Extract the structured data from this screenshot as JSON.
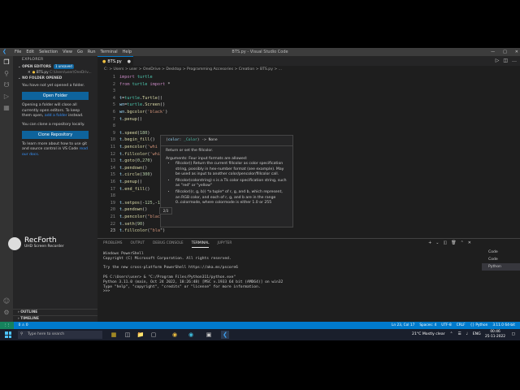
{
  "titlebar": {
    "menu": [
      "File",
      "Edit",
      "Selection",
      "View",
      "Go",
      "Run",
      "Terminal",
      "Help"
    ],
    "window_title": "BTS.py - Visual Studio Code"
  },
  "explorer": {
    "header": "EXPLORER",
    "open_editors_label": "OPEN EDITORS",
    "unsaved_badge": "1 unsaved",
    "open_file_name": "BTS.py",
    "open_file_path": "C:\\Users\\user\\OneDriv...",
    "no_folder_label": "NO FOLDER OPENED",
    "msg1": "You have not yet opened a folder.",
    "open_folder_btn": "Open Folder",
    "msg2": "Opening a folder will close all currently open editors. To keep them open,",
    "msg2_link": "add a folder",
    "msg2_end": "instead.",
    "msg3": "You can clone a repository locally.",
    "clone_btn": "Clone Repository",
    "msg4": "To learn more about how to use git and source control in VS Code",
    "msg4_link": "read our docs.",
    "outline_label": "OUTLINE",
    "timeline_label": "TIMELINE"
  },
  "tab": {
    "name": "BTS.py"
  },
  "breadcrumb": "C: > Users > user > OneDrive > Desktop > Programming Accesories > Creation > BTS.py > ...",
  "editor": {
    "lines": [
      {
        "n": "1",
        "html": "<span class='kw'>import</span> <span class='md'>turtle</span>"
      },
      {
        "n": "2",
        "html": "<span class='kw'>from</span> <span class='md'>turtle</span> <span class='kw'>import</span> *"
      },
      {
        "n": "3",
        "html": ""
      },
      {
        "n": "4",
        "html": "<span class='vr'>t</span>=<span class='md'>turtle</span>.<span class='fn'>Turtle</span>()"
      },
      {
        "n": "5",
        "html": "<span class='vr'>wn</span>=<span class='md'>turtle</span>.<span class='fn'>Screen</span>()"
      },
      {
        "n": "6",
        "html": "<span class='vr'>wn</span>.<span class='fn'>bgcolor</span>(<span class='st'>'black'</span>)"
      },
      {
        "n": "7",
        "html": "<span class='vr'>t</span>.<span class='fn'>penup</span>()"
      },
      {
        "n": "8",
        "html": ""
      },
      {
        "n": "9",
        "html": "<span class='vr'>t</span>.<span class='fn'>speed</span>(<span class='nm'>180</span>)"
      },
      {
        "n": "10",
        "html": "<span class='vr'>t</span>.<span class='fn'>begin_fill</span>()"
      },
      {
        "n": "11",
        "html": "<span class='vr'>t</span>.<span class='fn'>pencolor</span>(<span class='st'>'whi</span>"
      },
      {
        "n": "12",
        "html": "<span class='vr'>t</span>.<span class='fn'>fillcolor</span>(<span class='st'>'whi</span>"
      },
      {
        "n": "13",
        "html": "<span class='vr'>t</span>.<span class='fn'>goto</span>(<span class='nm'>0</span>,<span class='nm'>270</span>)"
      },
      {
        "n": "14",
        "html": "<span class='vr'>t</span>.<span class='fn'>pendown</span>()"
      },
      {
        "n": "15",
        "html": "<span class='vr'>t</span>.<span class='fn'>circle</span>(<span class='nm'>300</span>)"
      },
      {
        "n": "16",
        "html": "<span class='vr'>t</span>.<span class='fn'>penup</span>()"
      },
      {
        "n": "17",
        "html": "<span class='vr'>t</span>.<span class='fn'>end_fill</span>()"
      },
      {
        "n": "18",
        "html": ""
      },
      {
        "n": "19",
        "html": "<span class='vr'>t</span>.<span class='fn'>setpos</span>(-<span class='nm'>125</span>,-<span class='nm'>1</span>"
      },
      {
        "n": "20",
        "html": "<span class='vr'>t</span>.<span class='fn'>pendown</span>()"
      },
      {
        "n": "21",
        "html": "<span class='vr'>t</span>.<span class='fn'>pencolor</span>(<span class='st'>\"blac</span>"
      },
      {
        "n": "22",
        "html": "<span class='vr'>t</span>.<span class='fn'>seth</span>(<span class='nm'>90</span>)"
      },
      {
        "n": "23",
        "html": "<span class='vr'>t</span>.<span class='fn'>fillcolor</span>(<span class='st'>\"bla</span>\")"
      }
    ],
    "current_line": "23"
  },
  "hover": {
    "sig_param": "color",
    "sig_type": "_Color",
    "sig_ret": "-> None",
    "desc": "Return or set the fillcolor.",
    "args_head": "Arguments: Four input formats are allowed:",
    "items": [
      "fillcolor() Return the current fillcolor as color specification string, possibly in hex-number format (see example). May be used as input to another color/pencolor/fillcolor call.",
      "fillcolor(colorstring) s is a Tk color specification string, such as \"red\" or \"yellow\"",
      "fillcolor((r, g, b)) *a tuple* of r, g, and b, which represent, an RGB color, and each of r, g, and b are in the range 0..colormode, where colormode is either 1.0 or 255"
    ]
  },
  "param_hint": "2/3",
  "panel": {
    "tabs": [
      "PROBLEMS",
      "OUTPUT",
      "DEBUG CONSOLE",
      "TERMINAL",
      "JUPYTER"
    ],
    "active_tab": "TERMINAL",
    "term_lines": [
      "Windows PowerShell",
      "Copyright (C) Microsoft Corporation. All rights reserved.",
      "",
      "Try the new cross-platform PowerShell https://aka.ms/pscore6",
      "",
      "PS C:\\Users\\user> & \"C:/Program Files/Python311/python.exe\"",
      "Python 3.11.0 (main, Oct 24 2022, 18:26:48) [MSC v.1933 64 bit (AMD64)] on win32",
      "Type \"help\", \"copyright\", \"credits\" or \"license\" for more information.",
      ">>>"
    ],
    "terminals": [
      "Code",
      "Code",
      "Python"
    ]
  },
  "status": {
    "left": [
      "0 ⚠ 0"
    ],
    "right": [
      "Ln 23, Col 17",
      "Spaces: 4",
      "UTF-8",
      "CRLF",
      "{} Python",
      "3.11.0 64-bit"
    ]
  },
  "taskbar": {
    "search_placeholder": "Type here to search",
    "weather": "21°C  Mostly clear",
    "lang": "ENG",
    "time": "00:46",
    "date": "25-11-2022"
  },
  "watermark": {
    "title": "RecForth",
    "subtitle": "UHD Screen Recorder"
  }
}
